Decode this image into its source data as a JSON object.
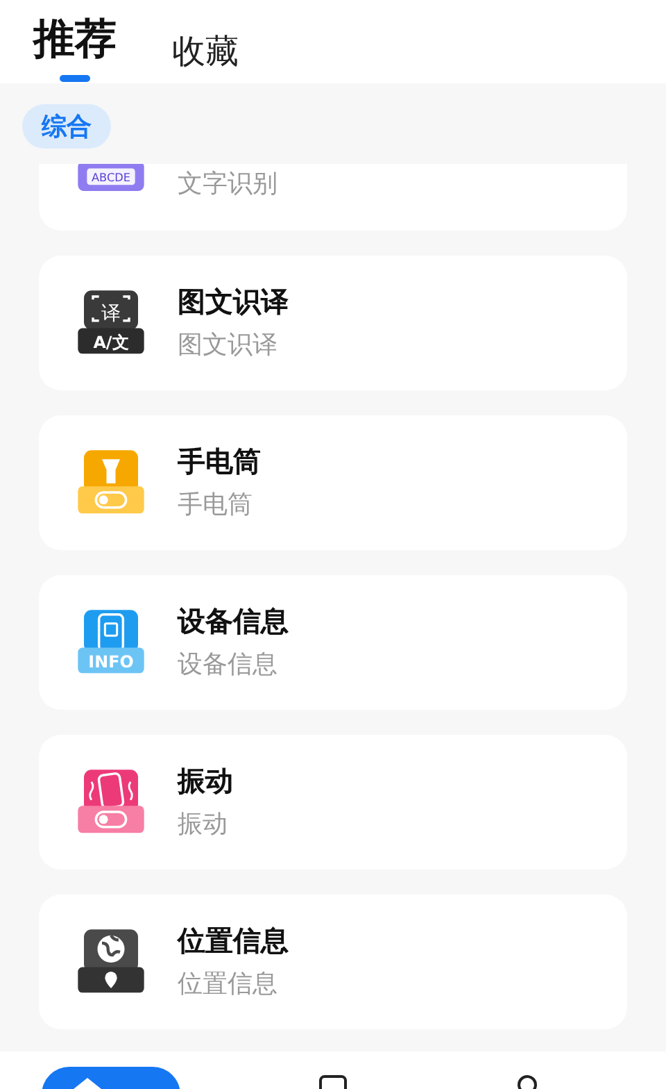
{
  "tabs": [
    {
      "label": "推荐",
      "selected": true
    },
    {
      "label": "收藏",
      "selected": false
    }
  ],
  "filters": [
    {
      "label": "综合",
      "selected": true
    }
  ],
  "tools": [
    {
      "kind": "ocr",
      "icon_text": "ABCDE",
      "subtitle": "文字识别"
    },
    {
      "kind": "translate",
      "icon_text": "译",
      "icon_caption": "A/文",
      "title": "图文识译",
      "subtitle": "图文识译"
    },
    {
      "kind": "flashlight",
      "title": "手电筒",
      "subtitle": "手电筒"
    },
    {
      "kind": "device",
      "icon_caption": "INFO",
      "title": "设备信息",
      "subtitle": "设备信息"
    },
    {
      "kind": "vibrate",
      "title": "振动",
      "subtitle": "振动"
    },
    {
      "kind": "location",
      "title": "位置信息",
      "subtitle": "位置信息"
    }
  ],
  "bottom_nav": [
    {
      "kind": "home",
      "selected": true
    },
    {
      "kind": "list",
      "selected": false
    },
    {
      "kind": "profile",
      "selected": false
    }
  ]
}
